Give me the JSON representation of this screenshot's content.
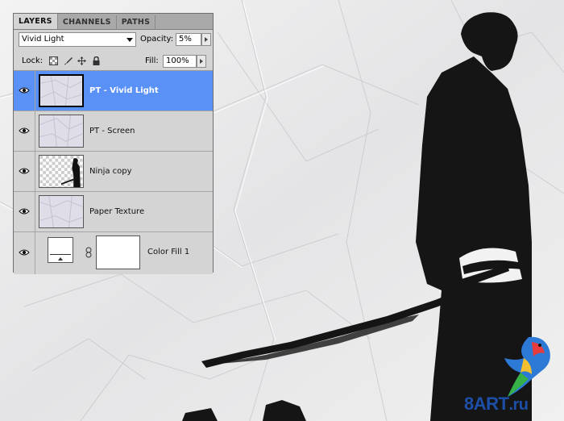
{
  "panel": {
    "tabs": [
      {
        "label": "LAYERS",
        "active": true
      },
      {
        "label": "CHANNELS",
        "active": false
      },
      {
        "label": "PATHS",
        "active": false
      }
    ],
    "blend_mode": "Vivid Light",
    "opacity_label": "Opacity:",
    "opacity_value": "5%",
    "lock_label": "Lock:",
    "fill_label": "Fill:",
    "fill_value": "100%",
    "layers": [
      {
        "name": "PT - Vivid Light",
        "selected": true,
        "visible": true,
        "thumb": "paper-texture"
      },
      {
        "name": "PT - Screen",
        "selected": false,
        "visible": true,
        "thumb": "paper-texture"
      },
      {
        "name": "Ninja copy",
        "selected": false,
        "visible": true,
        "thumb": "transparent-ninja"
      },
      {
        "name": "Paper Texture",
        "selected": false,
        "visible": true,
        "thumb": "paper-texture"
      },
      {
        "name": "Color Fill 1",
        "selected": false,
        "visible": true,
        "thumb": "color-fill-with-mask"
      }
    ]
  },
  "watermark": {
    "brand": "8ART",
    "suffix": ".ru"
  },
  "colors": {
    "selection": "#5991f7",
    "panel_bg": "#d4d4d4",
    "silhouette": "#151515"
  }
}
